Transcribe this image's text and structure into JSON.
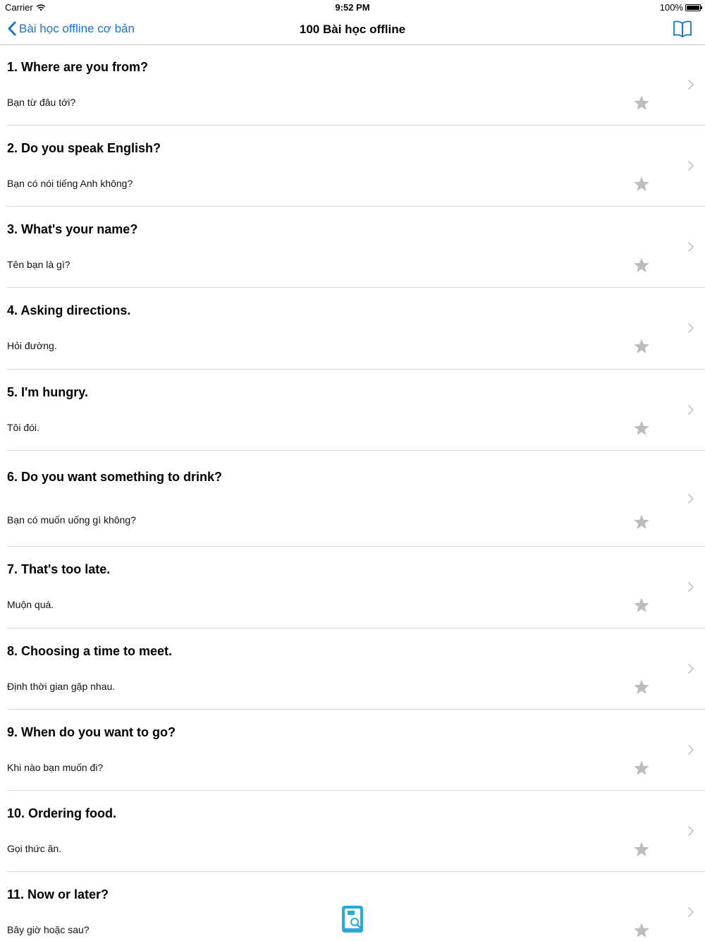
{
  "status_bar": {
    "carrier": "Carrier",
    "time": "9:52 PM",
    "battery": "100%"
  },
  "nav": {
    "back_label": "Bài học offline cơ bản",
    "title": "100 Bài học offline",
    "accent_color": "#1a75d1",
    "right_icon": "book-icon"
  },
  "lessons": [
    {
      "title": "1. Where are you from?",
      "subtitle": "Bạn từ đâu tới?"
    },
    {
      "title": "2. Do you speak English?",
      "subtitle": "Bạn có nói tiếng Anh không?"
    },
    {
      "title": "3. What's your name?",
      "subtitle": "Tên bạn là gì?"
    },
    {
      "title": "4. Asking directions.",
      "subtitle": "Hỏi đường."
    },
    {
      "title": "5. I'm hungry.",
      "subtitle": "Tôi đói."
    },
    {
      "title": "6. Do you want something to drink?",
      "subtitle": "Bạn có muốn uống gì không?"
    },
    {
      "title": "7. That's too late.",
      "subtitle": "Muộn quá."
    },
    {
      "title": "8. Choosing a time to meet.",
      "subtitle": "Định thời gian gặp nhau."
    },
    {
      "title": "9. When do you want to go?",
      "subtitle": "Khi nào bạn muốn đi?"
    },
    {
      "title": "10. Ordering food.",
      "subtitle": "Gọi thức ăn."
    },
    {
      "title": "11. Now or later?",
      "subtitle": "Bây giờ hoặc sau?"
    }
  ],
  "icons": {
    "star": "star-icon",
    "chevron": "chevron-right-icon",
    "floating": "dictionary-app-icon"
  },
  "colors": {
    "star": "#bdbdbd",
    "chevron": "#c7c7cc",
    "floating_icon": "#29a8e0"
  }
}
